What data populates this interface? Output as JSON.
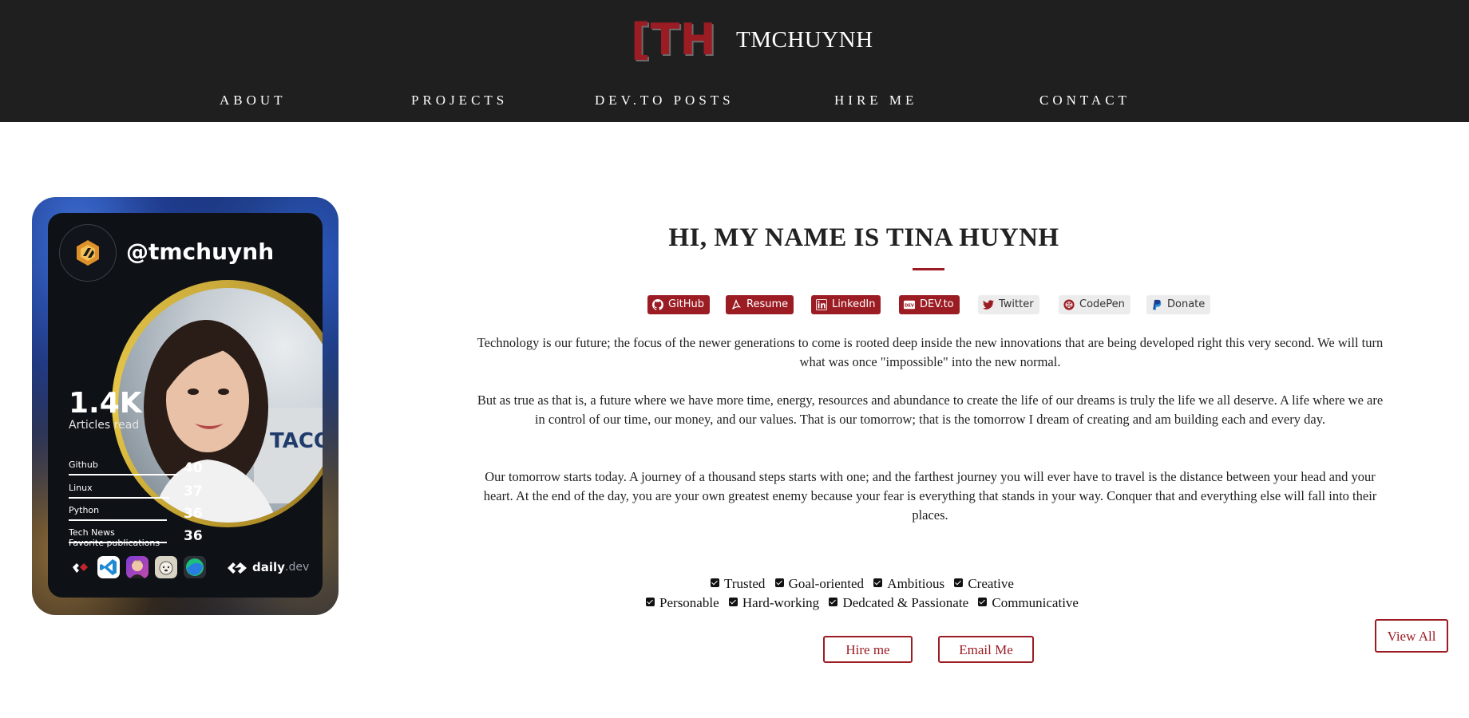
{
  "header": {
    "logo_text": "[TH]",
    "brand": "TMCHUYNH",
    "nav": [
      "ABOUT",
      "PROJECTS",
      "DEV.TO POSTS",
      "HIRE ME",
      "CONTACT"
    ]
  },
  "card": {
    "handle": "@tmchuynh",
    "articles_count": "1.4K",
    "articles_label": "Articles read",
    "tags": [
      {
        "label": "Github",
        "value": "40",
        "fraction": 1.0
      },
      {
        "label": "Linux",
        "value": "37",
        "fraction": 0.92
      },
      {
        "label": "Python",
        "value": "36",
        "fraction": 0.9
      },
      {
        "label": "Tech News",
        "value": "36",
        "fraction": 0.9
      }
    ],
    "favorites_label": "Favorite publications",
    "footer_brand": "daily",
    "footer_brand_suffix": ".dev"
  },
  "main": {
    "title": "HI, MY NAME IS TINA HUYNH",
    "accent_color": "#9b1c23",
    "badges": [
      {
        "label": "GitHub",
        "icon": "github-icon",
        "style": "dark"
      },
      {
        "label": "Resume",
        "icon": "pdf-icon",
        "style": "dark"
      },
      {
        "label": "LinkedIn",
        "icon": "linkedin-icon",
        "style": "dark"
      },
      {
        "label": "DEV.to",
        "icon": "devto-icon",
        "style": "dark"
      },
      {
        "label": "Twitter",
        "icon": "twitter-icon",
        "style": "light"
      },
      {
        "label": "CodePen",
        "icon": "codepen-icon",
        "style": "light"
      },
      {
        "label": "Donate",
        "icon": "paypal-icon",
        "style": "light"
      }
    ],
    "paragraphs": [
      "Technology is our future; the focus of the newer generations to come is rooted deep inside the new innovations that are being developed right this very second. We will turn what was once \"impossible\" into the new normal.",
      "But as true as that is, a future where we have more time, energy, resources and abundance to create the life of our dreams is truly the life we all deserve. A life where we are in control of our time, our money, and our values. That is our tomorrow; that is the tomorrow I dream of creating and am building each and every day.",
      "Our tomorrow starts today. A journey of a thousand steps starts with one; and the farthest journey you will ever have to travel is the distance between your head and your heart. At the end of the day, you are your own greatest enemy because your fear is everything that stands in your way. Conquer that and everything else will fall into their places."
    ],
    "traits_row1": [
      "Trusted",
      "Goal-oriented",
      "Ambitious",
      "Creative"
    ],
    "traits_row2": [
      "Personable",
      "Hard-working",
      "Dedcated & Passionate",
      "Communicative"
    ],
    "hire_button": "Hire me",
    "email_button": "Email Me",
    "view_all_button": "View All"
  }
}
